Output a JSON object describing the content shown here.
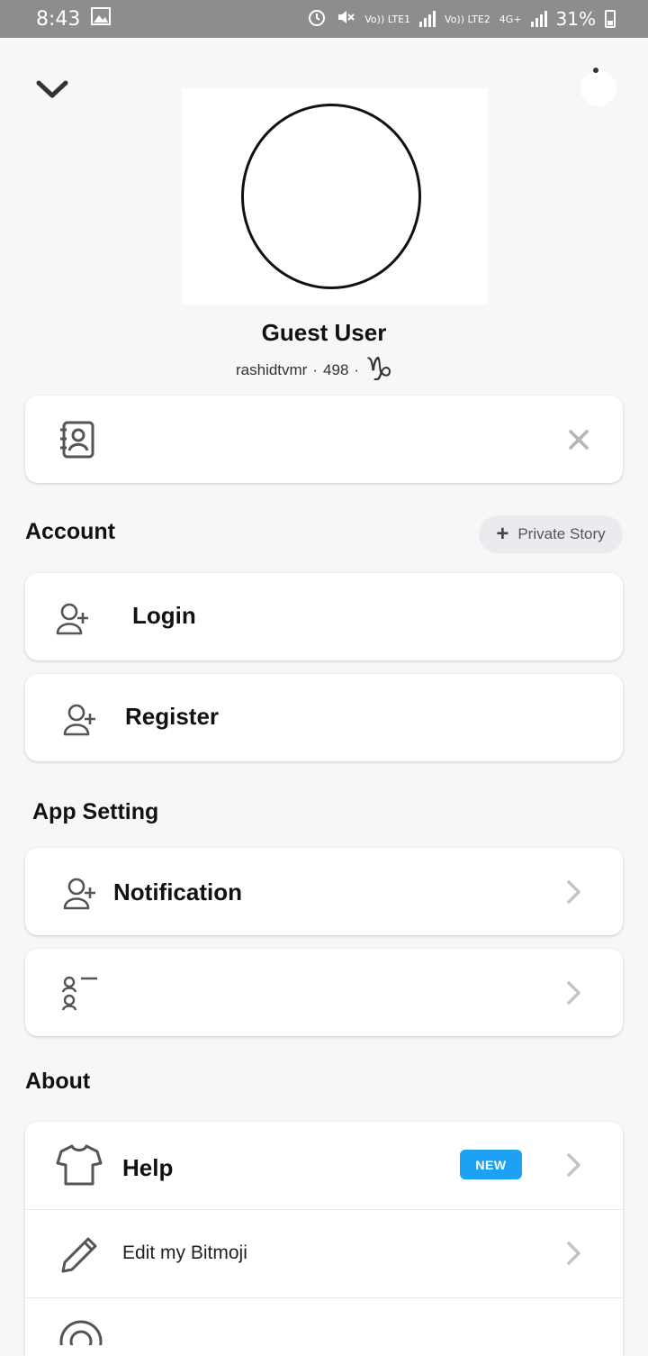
{
  "statusbar": {
    "time": "8:43",
    "sim1": "Vo)) LTE1",
    "sim2": "Vo)) LTE2",
    "net": "4G+",
    "battery": "31%"
  },
  "profile": {
    "display_name": "Guest User",
    "username": "rashidtvmr",
    "score": "498",
    "zodiac_symbol": "♑"
  },
  "prompt_card": {
    "icon": "contacts-book-icon"
  },
  "stories": {
    "pill_label": "Private Story"
  },
  "sections": {
    "account": "Account",
    "app_setting": "App Setting",
    "about": "About"
  },
  "account_items": [
    {
      "label": "Login",
      "icon": "add-user-icon"
    },
    {
      "label": "Register",
      "icon": "add-user-icon"
    }
  ],
  "settings_items": [
    {
      "label": "Notification",
      "icon": "add-user-icon"
    },
    {
      "label": "",
      "icon": "user-list-icon"
    }
  ],
  "about_items": [
    {
      "label": "Help",
      "icon": "tshirt-icon",
      "badge": "NEW"
    },
    {
      "label": "Edit my Bitmoji",
      "icon": "pencil-icon"
    },
    {
      "label": "",
      "icon": "camera-icon"
    }
  ],
  "colors": {
    "statusbar": "#8d8d8d",
    "background": "#f7f7f7",
    "badge": "#1da1f2"
  }
}
